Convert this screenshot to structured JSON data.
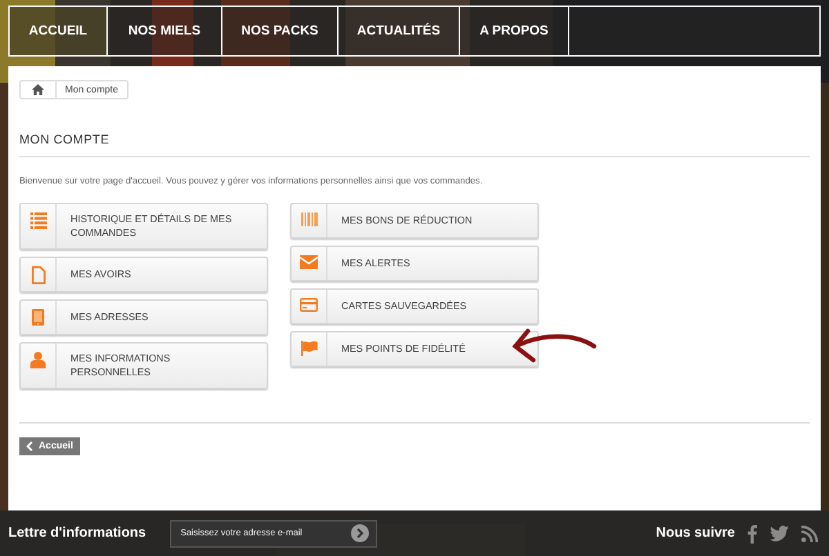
{
  "nav": [
    {
      "label": "ACCUEIL",
      "selected": true
    },
    {
      "label": "NOS MIELS",
      "selected": false
    },
    {
      "label": "NOS PACKS",
      "selected": false
    },
    {
      "label": "ACTUALITÉS",
      "selected": false
    },
    {
      "label": "A PROPOS",
      "selected": false
    }
  ],
  "breadcrumb": {
    "current": "Mon compte"
  },
  "page_title": "MON COMPTE",
  "intro": "Bienvenue sur votre page d'accueil. Vous pouvez y gérer vos informations personnelles ainsi que vos commandes.",
  "left_links": [
    {
      "kind": "list",
      "label": "HISTORIQUE ET DÉTAILS DE MES COMMANDES"
    },
    {
      "kind": "file",
      "label": "MES AVOIRS"
    },
    {
      "kind": "tablet",
      "label": "MES ADRESSES"
    },
    {
      "kind": "user",
      "label": "MES INFORMATIONS PERSONNELLES"
    }
  ],
  "right_links": [
    {
      "kind": "barcode",
      "label": "MES BONS DE RÉDUCTION"
    },
    {
      "kind": "envelope",
      "label": "MES ALERTES"
    },
    {
      "kind": "card",
      "label": "CARTES SAUVEGARDÉES"
    },
    {
      "kind": "flag",
      "label": "MES POINTS DE FIDÉLITÉ"
    }
  ],
  "back_button": "Accueil",
  "footer": {
    "newsletter_title": "Lettre d'informations",
    "email_placeholder": "Saisissez votre adresse e-mail",
    "follow_title": "Nous suivre"
  }
}
